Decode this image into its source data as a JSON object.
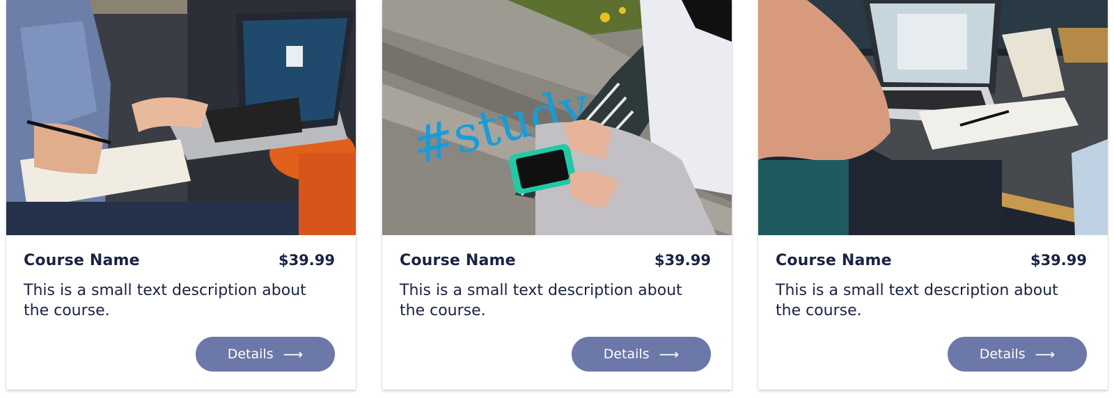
{
  "cards": [
    {
      "image": "laptop-notebook-photo",
      "name": "Course Name",
      "price": "$39.99",
      "description": "This is a small text description about the course.",
      "button_label": "Details",
      "button_icon": "arrow-right-icon"
    },
    {
      "image": "study-phone-photo",
      "name": "Course Name",
      "price": "$39.99",
      "description": "This is a small text description about the course.",
      "button_label": "Details",
      "button_icon": "arrow-right-icon"
    },
    {
      "image": "laptop-desk-photo",
      "name": "Course Name",
      "price": "$39.99",
      "description": "This is a small text description about the course.",
      "button_label": "Details",
      "button_icon": "arrow-right-icon"
    }
  ],
  "colors": {
    "text": "#1a2244",
    "button": "#6b78a8",
    "button_text": "#ffffff"
  }
}
